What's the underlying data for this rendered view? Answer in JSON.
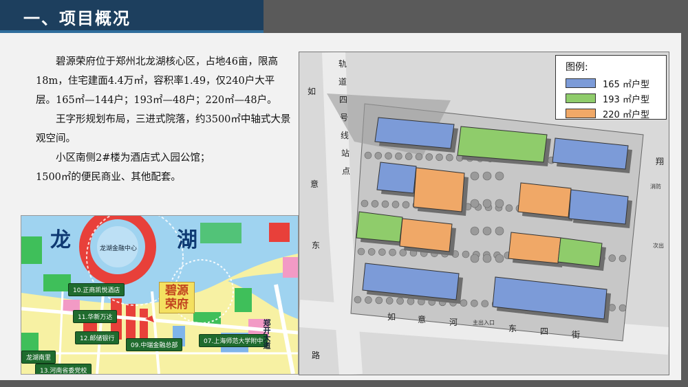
{
  "header": {
    "title": "一、项目概况"
  },
  "intro": {
    "paragraphs": [
      "碧源荣府位于郑州北龙湖核心区，占地46亩，限高18m，住宅建面4.4万㎡，容积率1.49，仅240户大平层。165㎡—144户；193㎡—48户；220㎡—48户。",
      "王字形规划布局，三进式院落，约3500㎡中轴式大景观空间。",
      "小区南侧2#楼为酒店式入园公馆；",
      "1500㎡的便民商业、其他配套。"
    ]
  },
  "location_map": {
    "lake_chars": [
      "龙",
      "湖"
    ],
    "center_label": "龙湖金融中心",
    "project_label": "碧源荣府",
    "poi": [
      "10.正商凯悦酒店",
      "11.华新万达",
      "12.邮储银行",
      "09.中瑞金融总部",
      "07.上海师范大学附中",
      "龙湖南里",
      "13.河南省委党校"
    ],
    "road_text": "郑开大道",
    "colors": {
      "residential": "#f7f1a3",
      "water": "#9fd3f0",
      "commercial": "#e8403a",
      "green": "#3fbf5a",
      "edu": "#f29ac5"
    }
  },
  "site_plan": {
    "legend": {
      "title": "图例:",
      "items": [
        {
          "label": "165 ㎡户型",
          "color": "#7c9bd8"
        },
        {
          "label": "193 ㎡户型",
          "color": "#8fcc6b"
        },
        {
          "label": "220 ㎡户型",
          "color": "#f0a867"
        }
      ]
    },
    "road_labels": {
      "north_vertical": [
        "轨",
        "道",
        "四",
        "号",
        "线",
        "站",
        "点"
      ],
      "west_vertical_top": "如",
      "west_vertical": [
        "意",
        "东"
      ],
      "west_bottom": "路",
      "south_road": [
        "如",
        "意",
        "河",
        "东",
        "四",
        "街"
      ],
      "east_chars": [
        "翔",
        "次出"
      ],
      "entrance": "主出入口",
      "exit_right": "消防"
    }
  }
}
